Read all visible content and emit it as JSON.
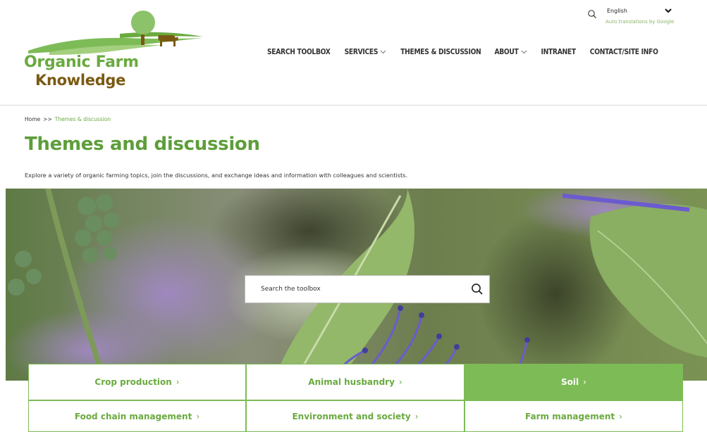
{
  "site": {
    "logo_line1": "Organic Farm",
    "logo_line2": "Knowledge"
  },
  "language": {
    "selected": "English",
    "powered_by": "Auto translations by Google"
  },
  "nav": {
    "items": [
      {
        "label": "SEARCH TOOLBOX",
        "dropdown": false
      },
      {
        "label": "SERVICES",
        "dropdown": true
      },
      {
        "label": "THEMES & DISCUSSION",
        "dropdown": false
      },
      {
        "label": "ABOUT",
        "dropdown": true
      },
      {
        "label": "INTRANET",
        "dropdown": false
      },
      {
        "label": "CONTACT/SITE INFO",
        "dropdown": false
      }
    ]
  },
  "breadcrumb": {
    "home": "Home",
    "separator": ">>",
    "current": "Themes & discussion"
  },
  "page": {
    "title": "Themes and discussion",
    "intro": "Explore a variety of organic farming topics, join the discussions, and exchange ideas and information with colleagues and scientists."
  },
  "search": {
    "placeholder": "Search the toolbox"
  },
  "tiles": [
    {
      "label": "Crop production",
      "active": false
    },
    {
      "label": "Animal husbandry",
      "active": false
    },
    {
      "label": "Soil",
      "active": true
    },
    {
      "label": "Food chain management",
      "active": false
    },
    {
      "label": "Environment and society",
      "active": false
    },
    {
      "label": "Farm management",
      "active": false
    }
  ],
  "colors": {
    "brand_green": "#6aaa3f",
    "tile_green": "#7dbb57",
    "brand_brown": "#7a5a12"
  }
}
